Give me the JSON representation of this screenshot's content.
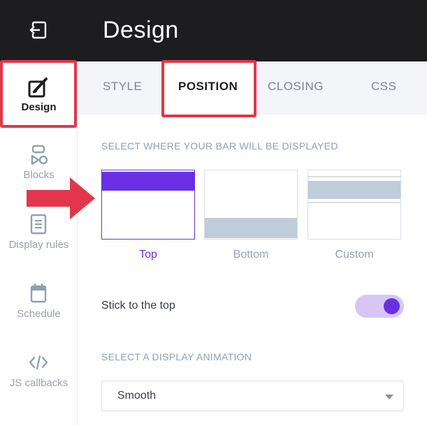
{
  "header": {
    "title": "Design"
  },
  "sidebar": {
    "items": [
      {
        "label": "Design",
        "icon": "paintbrush-icon",
        "active": true
      },
      {
        "label": "Blocks",
        "icon": "blocks-icon"
      },
      {
        "label": "Display rules",
        "icon": "document-icon"
      },
      {
        "label": "Schedule",
        "icon": "calendar-icon"
      },
      {
        "label": "JS callbacks",
        "icon": "code-icon"
      }
    ]
  },
  "tabs": [
    {
      "label": "STYLE"
    },
    {
      "label": "POSITION",
      "active": true
    },
    {
      "label": "CLOSING"
    },
    {
      "label": "CSS"
    }
  ],
  "position_section": {
    "label": "SELECT WHERE YOUR BAR WILL BE DISPLAYED",
    "options": [
      {
        "label": "Top",
        "selected": true
      },
      {
        "label": "Bottom"
      },
      {
        "label": "Custom"
      }
    ]
  },
  "stick": {
    "label": "Stick to the top",
    "on": true
  },
  "animation_section": {
    "label": "SELECT A DISPLAY ANIMATION",
    "value": "Smooth"
  },
  "colors": {
    "accent": "#6930e3",
    "highlight": "#e2364c",
    "dark": "#1d1d20",
    "bar_gray": "#bfccd9"
  }
}
